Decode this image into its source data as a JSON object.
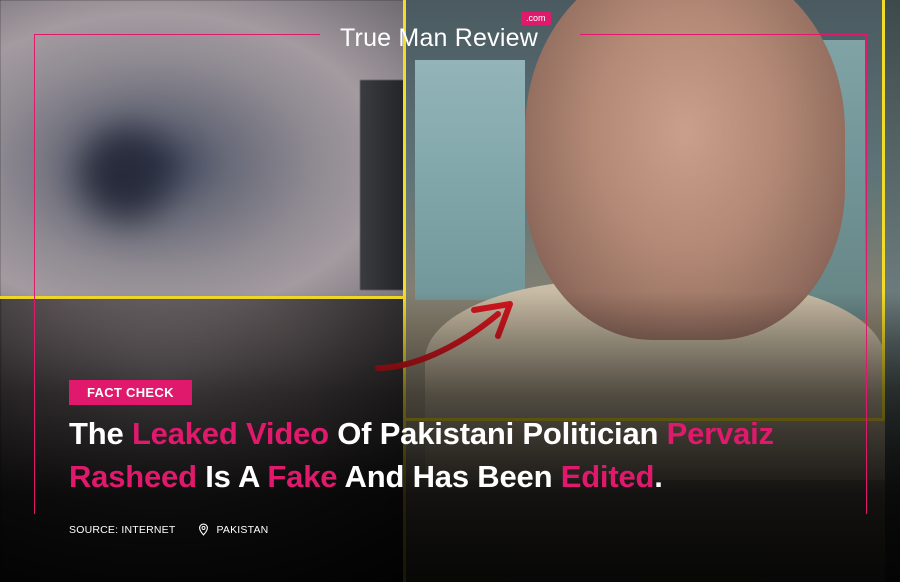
{
  "logo": {
    "name": "True Man Review",
    "badge": ".com"
  },
  "tag": {
    "label": "FACT CHECK"
  },
  "headline": {
    "segments": [
      {
        "text": "The ",
        "highlight": false
      },
      {
        "text": "Leaked Video",
        "highlight": true
      },
      {
        "text": " Of Pakistani Politician ",
        "highlight": false
      },
      {
        "text": "Pervaiz Rasheed",
        "highlight": true
      },
      {
        "text": " Is A ",
        "highlight": false
      },
      {
        "text": "Fake",
        "highlight": true
      },
      {
        "text": " And Has Been ",
        "highlight": false
      },
      {
        "text": "Edited",
        "highlight": true
      },
      {
        "text": ".",
        "highlight": false
      }
    ]
  },
  "meta": {
    "source": "SOURCE: INTERNET",
    "location": "PAKISTAN",
    "location_icon": "map-pin-icon"
  },
  "colors": {
    "accent": "#e0196d",
    "frame_yellow": "#f2dc2a",
    "text": "#ffffff"
  }
}
